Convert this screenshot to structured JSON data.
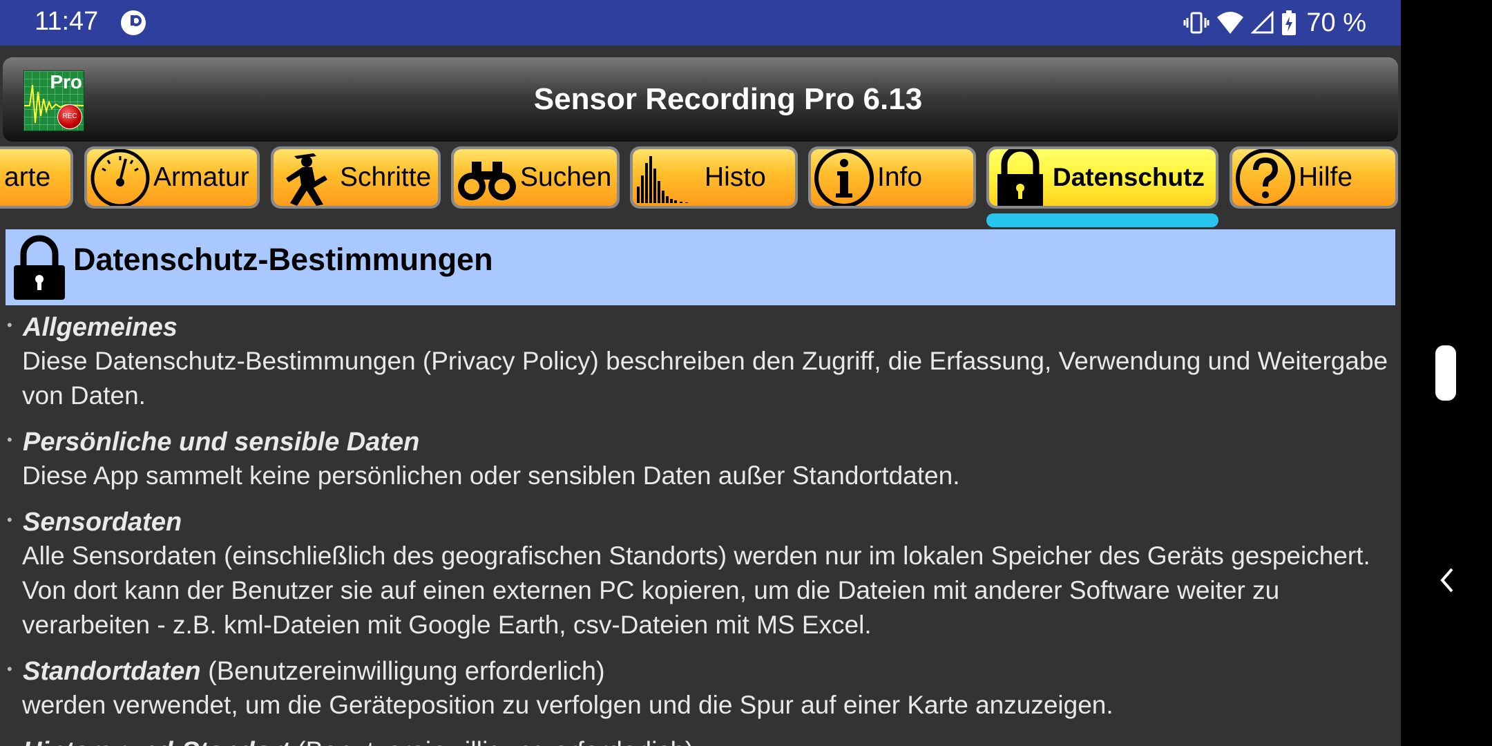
{
  "status_bar": {
    "time": "11:47",
    "battery": "70 %"
  },
  "app": {
    "title": "Sensor Recording Pro 6.13",
    "logo_text": "Pro",
    "logo_badge": "REC"
  },
  "tabs": [
    {
      "label": "arte",
      "icon": "map-icon"
    },
    {
      "label": "Armatur",
      "icon": "gauge-icon"
    },
    {
      "label": "Schritte",
      "icon": "walking-man-icon"
    },
    {
      "label": "Suchen",
      "icon": "binoculars-icon"
    },
    {
      "label": "Histo",
      "icon": "histogram-icon"
    },
    {
      "label": "Info",
      "icon": "info-icon"
    },
    {
      "label": "Datenschutz",
      "icon": "lock-icon",
      "active": true
    },
    {
      "label": "Hilfe",
      "icon": "help-icon"
    }
  ],
  "content": {
    "title": "Datenschutz-Bestimmungen",
    "sections": [
      {
        "title": "Allgemeines",
        "suffix": "",
        "body": "Diese Datenschutz-Bestimmungen (Privacy Policy) beschreiben den Zugriff, die Erfassung, Verwendung und Weitergabe von Daten."
      },
      {
        "title": "Persönliche und sensible Daten",
        "suffix": "",
        "body": "Diese App sammelt keine persönlichen oder sensiblen Daten außer Standortdaten."
      },
      {
        "title": "Sensordaten",
        "suffix": "",
        "body": "Alle Sensordaten (einschließlich des geografischen Standorts) werden nur im lokalen Speicher des Geräts gespeichert. Von dort kann der Benutzer sie auf einen externen PC kopieren, um die Dateien mit anderer Software weiter zu verarbeiten - z.B. kml-Dateien mit Google Earth, csv-Dateien mit MS Excel."
      },
      {
        "title": "Standortdaten",
        "suffix": " (Benutzereinwilligung erforderlich)",
        "body": "werden verwendet, um die Geräteposition zu verfolgen und die Spur auf einer Karte anzuzeigen."
      },
      {
        "title": "Hintergrund-Standort",
        "suffix": " (Benutzereinwilligung erforderlich)",
        "body": ""
      }
    ]
  }
}
